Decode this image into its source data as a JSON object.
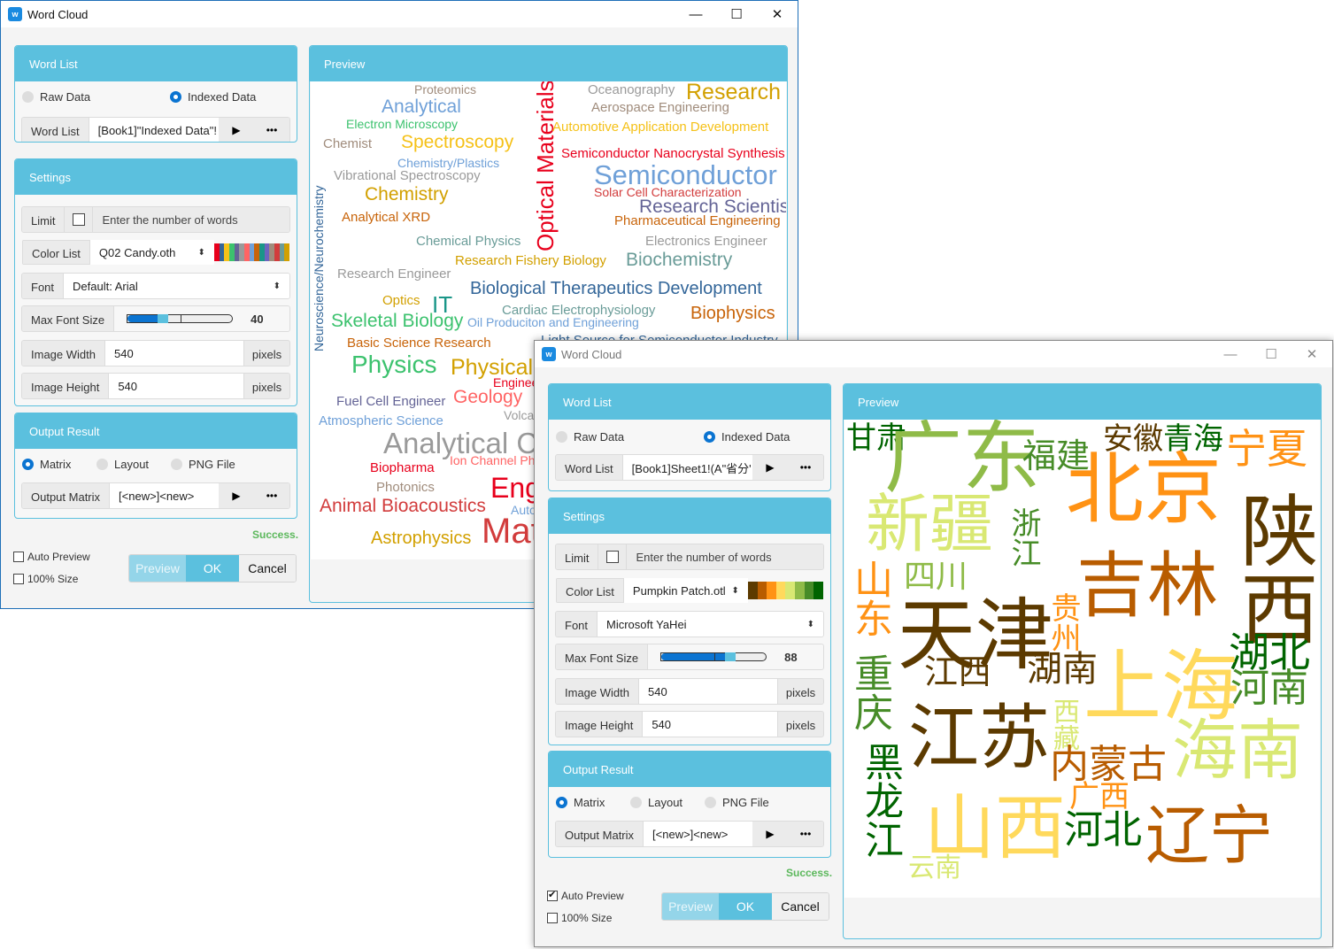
{
  "window1": {
    "title": "Word Cloud",
    "controls": {
      "minimize": "—",
      "maximize": "☐",
      "close": "✕"
    },
    "word_list": {
      "header": "Word List",
      "radio_raw": "Raw Data",
      "radio_indexed": "Indexed Data",
      "selected": "Indexed Data",
      "field_label": "Word List",
      "field_value": "[Book1]\"Indexed Data\"!",
      "run_icon": "▶",
      "more_icon": "•••"
    },
    "settings": {
      "header": "Settings",
      "limit_label": "Limit",
      "limit_checked": false,
      "limit_placeholder": "Enter the number of words",
      "color_list_label": "Color List",
      "color_list_value": "Q02 Candy.oth",
      "color_swatches": [
        "#e8001c",
        "#336699",
        "#f5c118",
        "#3cc26e",
        "#646496",
        "#9a9a9a",
        "#ff6464",
        "#6fa0d8",
        "#c8640a",
        "#1a9688",
        "#6e64be",
        "#a08c7c",
        "#d23c3c",
        "#6a9c98",
        "#d2a000"
      ],
      "font_label": "Font",
      "font_value": "Default: Arial",
      "max_font_label": "Max Font Size",
      "max_font_value": "40",
      "max_font_fraction": 0.36,
      "width_label": "Image Width",
      "width_value": "540",
      "width_unit": "pixels",
      "height_label": "Image Height",
      "height_value": "540",
      "height_unit": "pixels"
    },
    "output": {
      "header": "Output Result",
      "radio_matrix": "Matrix",
      "radio_layout": "Layout",
      "radio_png": "PNG File",
      "selected": "Matrix",
      "field_label": "Output Matrix",
      "field_value": "[<new>]<new>",
      "run_icon": "▶",
      "more_icon": "•••"
    },
    "status": "Success.",
    "auto_preview_label": "Auto Preview",
    "auto_preview_checked": false,
    "full_size_label": "100% Size",
    "full_size_checked": false,
    "buttons": {
      "preview": "Preview",
      "ok": "OK",
      "cancel": "Cancel"
    },
    "preview": {
      "header": "Preview",
      "words": [
        {
          "text": "Proteomics",
          "color": "#a08c7c"
        },
        {
          "text": "Analytical",
          "color": "#6fa0d8"
        },
        {
          "text": "Electron Microscopy",
          "color": "#3cc26e"
        },
        {
          "text": "Chemist",
          "color": "#a08c7c"
        },
        {
          "text": "Spectroscopy",
          "color": "#f5c118"
        },
        {
          "text": "Chemistry/Plastics",
          "color": "#6fa0d8"
        },
        {
          "text": "Vibrational Spectroscopy",
          "color": "#9a9a9a"
        },
        {
          "text": "Chemistry",
          "color": "#d2a000"
        },
        {
          "text": "Analytical XRD",
          "color": "#c8640a"
        },
        {
          "text": "Chemical Physics",
          "color": "#6a9c98"
        },
        {
          "text": "Optical Materials",
          "color": "#e8001c"
        },
        {
          "text": "Oceanography",
          "color": "#9a9a9a"
        },
        {
          "text": "Research",
          "color": "#d2a000"
        },
        {
          "text": "Aerospace Engineering",
          "color": "#a08c7c"
        },
        {
          "text": "Automotive Application Development",
          "color": "#f5c118"
        },
        {
          "text": "Semiconductor Nanocrystal Synthesis",
          "color": "#e8001c"
        },
        {
          "text": "Semiconductor",
          "color": "#6fa0d8"
        },
        {
          "text": "Solar Cell Characterization",
          "color": "#d23c3c"
        },
        {
          "text": "Research Scientist",
          "color": "#646496"
        },
        {
          "text": "Pharmaceutical Engineering",
          "color": "#c8640a"
        },
        {
          "text": "Electronics Engineer",
          "color": "#9a9a9a"
        },
        {
          "text": "Research Fishery Biology",
          "color": "#d2a000"
        },
        {
          "text": "Biochemistry",
          "color": "#6a9c98"
        },
        {
          "text": "Neuroscience/Neurochemistry",
          "color": "#336699"
        },
        {
          "text": "Research Engineer",
          "color": "#9a9a9a"
        },
        {
          "text": "Biological Therapeutics Development",
          "color": "#336699"
        },
        {
          "text": "Optics",
          "color": "#d2a000"
        },
        {
          "text": "IT",
          "color": "#1a9688"
        },
        {
          "text": "Cardiac Electrophysiology",
          "color": "#6a9c98"
        },
        {
          "text": "Biophysics",
          "color": "#c8640a"
        },
        {
          "text": "Skeletal Biology",
          "color": "#3cc26e"
        },
        {
          "text": "Oil Produciton and Engineering",
          "color": "#6fa0d8"
        },
        {
          "text": "Basic Science Research",
          "color": "#c8640a"
        },
        {
          "text": "Light Source for Semiconductor Industry",
          "color": "#336699"
        },
        {
          "text": "Physics",
          "color": "#3cc26e"
        },
        {
          "text": "Physical",
          "color": "#d2a000"
        },
        {
          "text": "Enginee",
          "color": "#e8001c"
        },
        {
          "text": "Fuel Cell Engineer",
          "color": "#646496"
        },
        {
          "text": "Geology",
          "color": "#ff6464"
        },
        {
          "text": "Volca",
          "color": "#9a9a9a"
        },
        {
          "text": "Atmospheric Science",
          "color": "#6fa0d8"
        },
        {
          "text": "Analytical Ch",
          "color": "#9a9a9a"
        },
        {
          "text": "Ion Channel Ph",
          "color": "#ff6464"
        },
        {
          "text": "Biopharma",
          "color": "#e8001c"
        },
        {
          "text": "Photonics",
          "color": "#a08c7c"
        },
        {
          "text": "Eng",
          "color": "#e8001c"
        },
        {
          "text": "Animal Bioacoustics",
          "color": "#d23c3c"
        },
        {
          "text": "Auto",
          "color": "#6fa0d8"
        },
        {
          "text": "Astrophysics",
          "color": "#d2a000"
        },
        {
          "text": "Mat",
          "color": "#d23c3c"
        }
      ]
    }
  },
  "window2": {
    "title": "Word Cloud",
    "controls": {
      "minimize": "—",
      "maximize": "☐",
      "close": "✕"
    },
    "word_list": {
      "header": "Word List",
      "radio_raw": "Raw Data",
      "radio_indexed": "Indexed Data",
      "selected": "Indexed Data",
      "field_label": "Word List",
      "field_value": "[Book1]Sheet1!(A\"省分'",
      "run_icon": "▶",
      "more_icon": "•••"
    },
    "settings": {
      "header": "Settings",
      "limit_label": "Limit",
      "limit_checked": false,
      "limit_placeholder": "Enter the number of words",
      "color_list_label": "Color List",
      "color_list_value": "Pumpkin Patch.otl",
      "color_swatches": [
        "#5c3a00",
        "#b85c00",
        "#ff9214",
        "#ffd95c",
        "#d9e873",
        "#8fbb48",
        "#478c28",
        "#006400"
      ],
      "font_label": "Font",
      "font_value": "Microsoft YaHei",
      "max_font_label": "Max Font Size",
      "max_font_value": "88",
      "max_font_fraction": 0.66,
      "width_label": "Image Width",
      "width_value": "540",
      "width_unit": "pixels",
      "height_label": "Image Height",
      "height_value": "540",
      "height_unit": "pixels"
    },
    "output": {
      "header": "Output Result",
      "radio_matrix": "Matrix",
      "radio_layout": "Layout",
      "radio_png": "PNG File",
      "selected": "Matrix",
      "field_label": "Output Matrix",
      "field_value": "[<new>]<new>",
      "run_icon": "▶",
      "more_icon": "•••"
    },
    "status": "Success.",
    "auto_preview_label": "Auto Preview",
    "auto_preview_checked": true,
    "full_size_label": "100% Size",
    "full_size_checked": false,
    "buttons": {
      "preview": "Preview",
      "ok": "OK",
      "cancel": "Cancel"
    },
    "preview": {
      "header": "Preview",
      "words": [
        {
          "text": "甘肃",
          "color": "#006400"
        },
        {
          "text": "广东",
          "color": "#8fbb48"
        },
        {
          "text": "福建",
          "color": "#478c28"
        },
        {
          "text": "安徽",
          "color": "#5c3a00"
        },
        {
          "text": "青海",
          "color": "#006400"
        },
        {
          "text": "宁夏",
          "color": "#ff9214"
        },
        {
          "text": "新疆",
          "color": "#d9e873"
        },
        {
          "text": "北京",
          "color": "#ff9214"
        },
        {
          "text": "浙江",
          "color": "#478c28"
        },
        {
          "text": "四川",
          "color": "#8fbb48"
        },
        {
          "text": "陕西",
          "color": "#5c3a00"
        },
        {
          "text": "山东",
          "color": "#ff9214"
        },
        {
          "text": "吉林",
          "color": "#b85c00"
        },
        {
          "text": "天津",
          "color": "#5c3a00"
        },
        {
          "text": "贵州",
          "color": "#ff9214"
        },
        {
          "text": "湖北",
          "color": "#006400"
        },
        {
          "text": "重庆",
          "color": "#478c28"
        },
        {
          "text": "江西",
          "color": "#5c3a00"
        },
        {
          "text": "湖南",
          "color": "#5c3a00"
        },
        {
          "text": "上海",
          "color": "#ffd95c"
        },
        {
          "text": "河南",
          "color": "#478c28"
        },
        {
          "text": "江苏",
          "color": "#5c3a00"
        },
        {
          "text": "西藏",
          "color": "#d9e873"
        },
        {
          "text": "海南",
          "color": "#d9e873"
        },
        {
          "text": "黑龙江",
          "color": "#006400"
        },
        {
          "text": "内蒙古",
          "color": "#b85c00"
        },
        {
          "text": "广西",
          "color": "#ff9214"
        },
        {
          "text": "山西",
          "color": "#ffd95c"
        },
        {
          "text": "河北",
          "color": "#006400"
        },
        {
          "text": "辽宁",
          "color": "#b85c00"
        },
        {
          "text": "云南",
          "color": "#d9e873"
        }
      ]
    }
  }
}
